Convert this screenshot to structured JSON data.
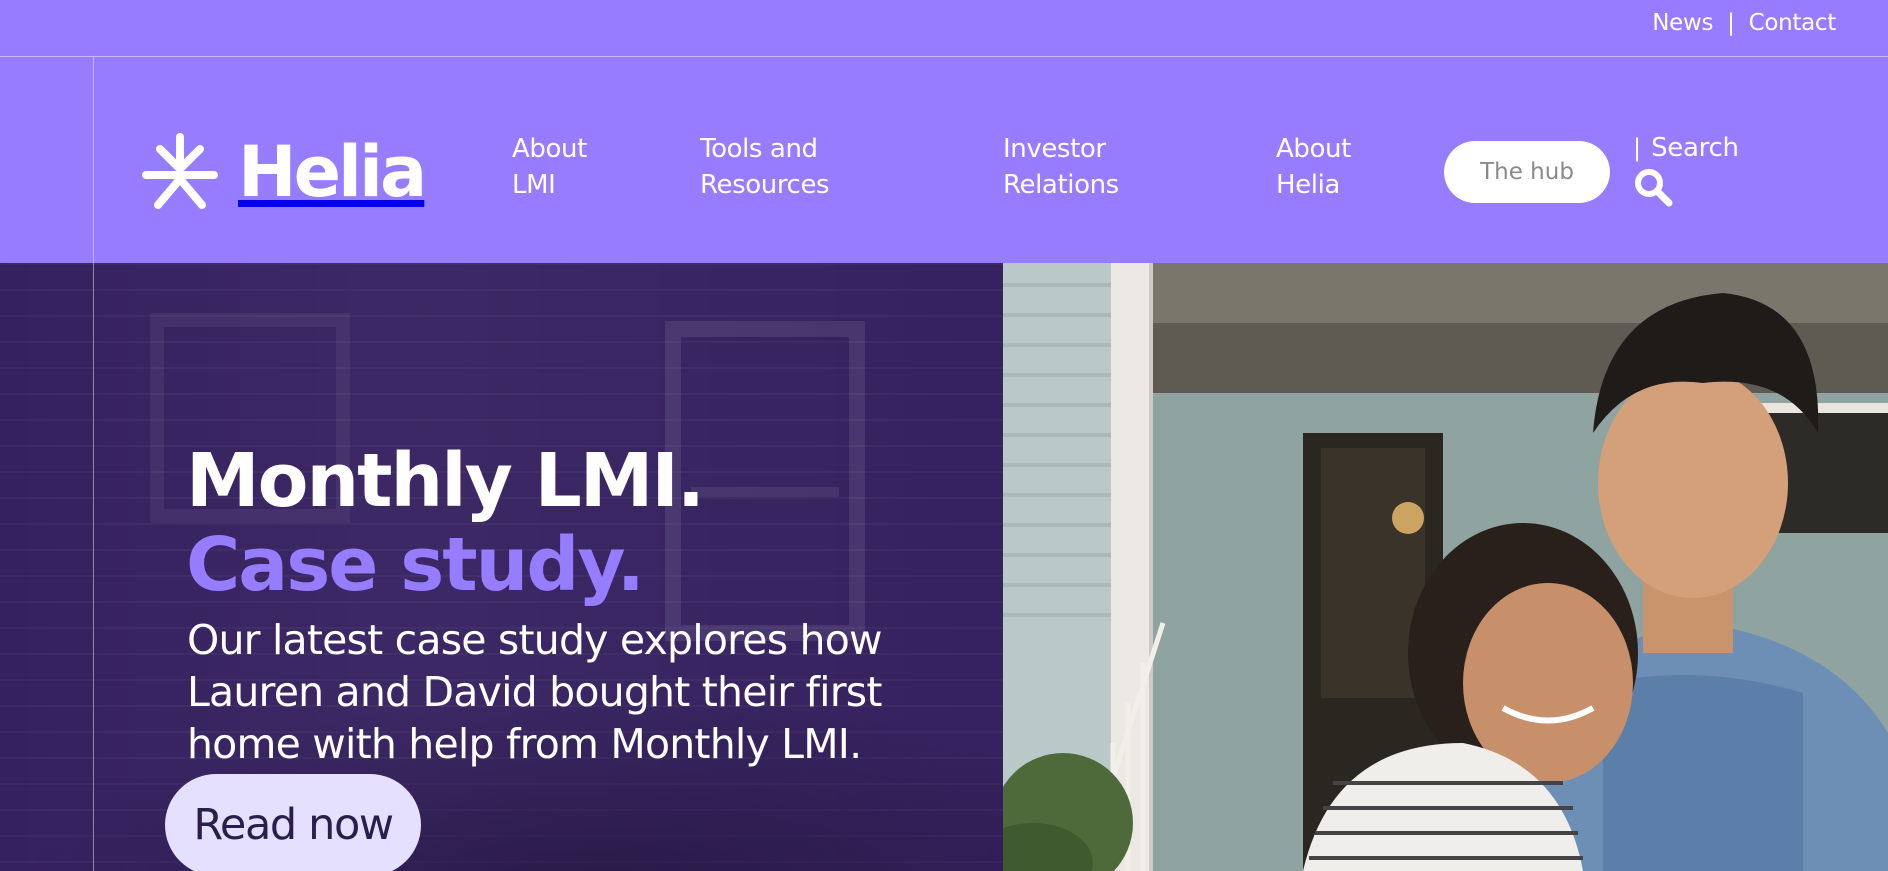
{
  "utility_nav": {
    "news": "News",
    "separator": "|",
    "contact": "Contact"
  },
  "brand": {
    "name": "Helia",
    "logo_icon": "asterisk-star-icon",
    "color": "#967dff"
  },
  "main_nav": {
    "items": [
      {
        "label_line1": "About",
        "label_line2": "LMI"
      },
      {
        "label_line1": "Tools and",
        "label_line2": "Resources"
      },
      {
        "label_line1": "Investor",
        "label_line2": "Relations"
      },
      {
        "label_line1": "About",
        "label_line2": "Helia"
      }
    ],
    "hub_button": "The hub",
    "search_separator": "|",
    "search_label": "Search",
    "search_icon": "search-icon"
  },
  "hero": {
    "title_line1": "Monthly LMI.",
    "title_line2": "Case study.",
    "description": "Our latest case study explores how Lauren and David bought their first home with help from Monthly LMI.",
    "cta": "Read now",
    "image_subject": "couple-embracing-photo",
    "colors": {
      "overlay": "#3a2a5e",
      "accent": "#967dff",
      "cta_background": "#e6e0ff",
      "cta_text": "#2a1e4a"
    }
  }
}
